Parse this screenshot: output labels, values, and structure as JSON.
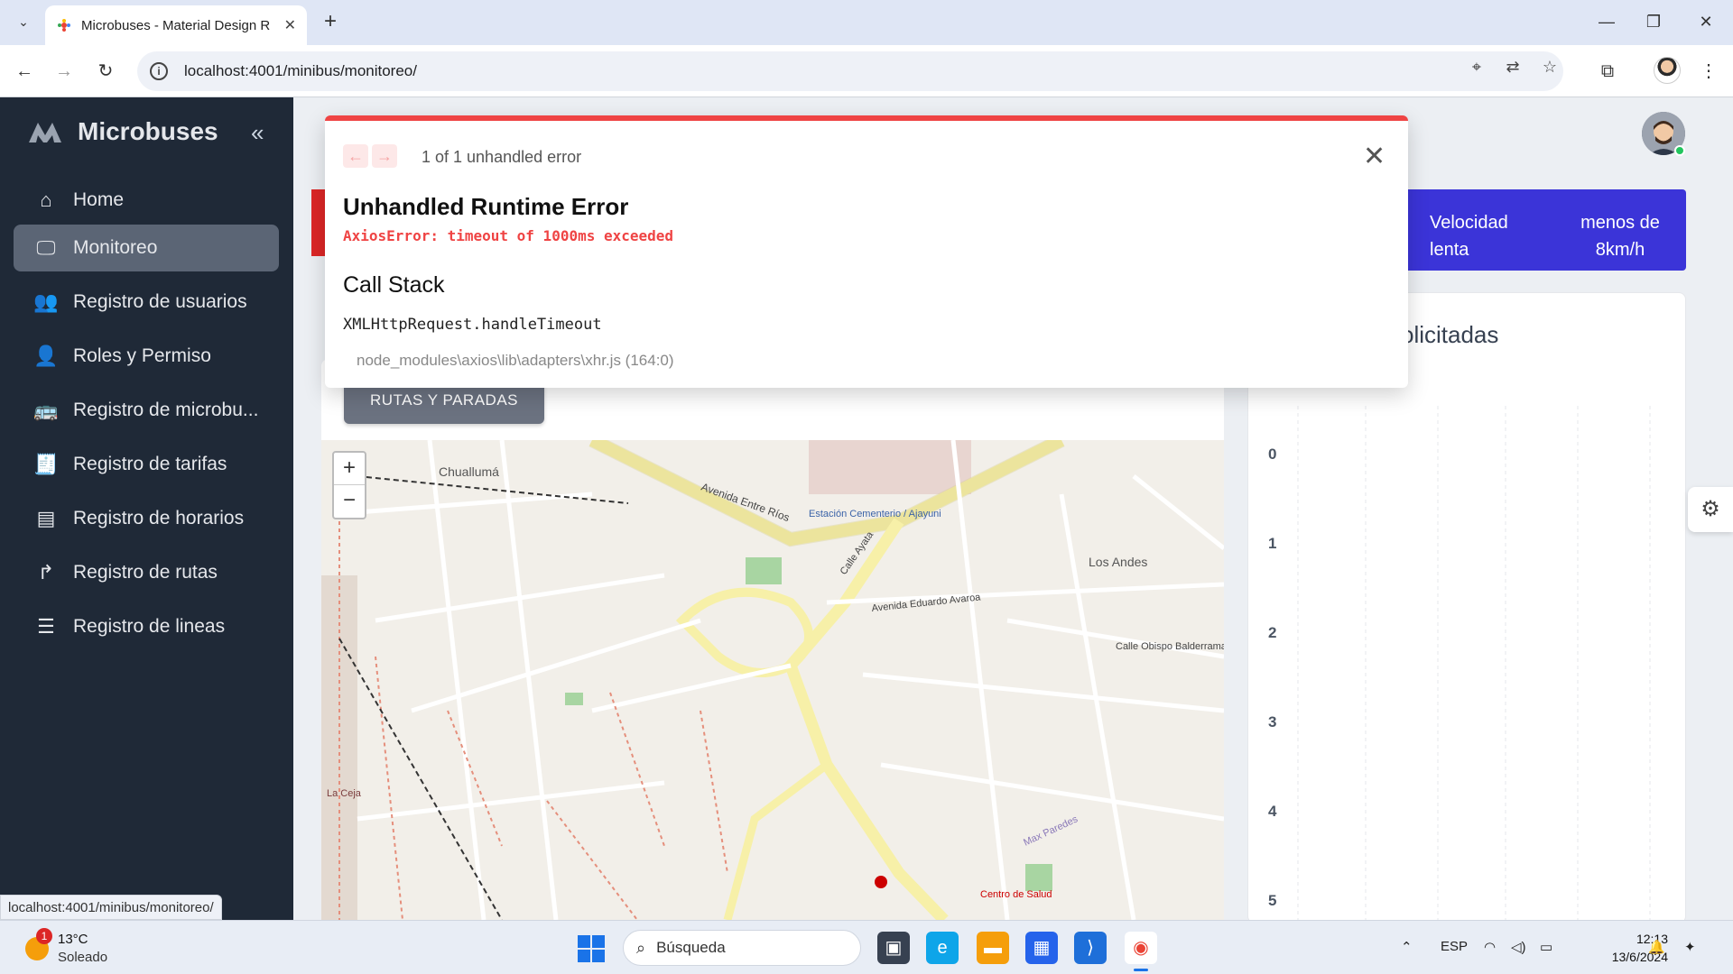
{
  "browser": {
    "tab_title": "Microbuses - Material Design R",
    "url": "localhost:4001/minibus/monitoreo/",
    "status_url": "localhost:4001/minibus/monitoreo/"
  },
  "sidebar": {
    "brand": "Microbuses",
    "items": [
      {
        "label": "Home",
        "icon": "home-icon"
      },
      {
        "label": "Monitoreo",
        "icon": "monitor-icon"
      },
      {
        "label": "Registro de usuarios",
        "icon": "users-icon"
      },
      {
        "label": "Roles y Permiso",
        "icon": "user-check-icon"
      },
      {
        "label": "Registro de microbu...",
        "icon": "bus-icon"
      },
      {
        "label": "Registro de tarifas",
        "icon": "receipt-icon"
      },
      {
        "label": "Registro de horarios",
        "icon": "schedule-icon"
      },
      {
        "label": "Registro de rutas",
        "icon": "route-icon"
      },
      {
        "label": "Registro de lineas",
        "icon": "list-icon"
      }
    ]
  },
  "main": {
    "speed_card": {
      "label": "Velocidad lenta",
      "value": "menos de 8km/h"
    },
    "routes_button": "RUTAS Y PARADAS",
    "chart_title": "olicitadas",
    "chart_ticks": [
      "0",
      "1",
      "2",
      "3",
      "4",
      "5"
    ],
    "map_zoom_in": "+",
    "map_zoom_out": "−",
    "map_labels": [
      "Chuallumá",
      "Avenida Entre Ríos",
      "Estación Cementerio / Ajayuni",
      "Los Andes",
      "Calle Ayata",
      "Avenida Eduardo Avaroa",
      "Max Paredes",
      "Centro de Salud",
      "La Ceja",
      "Calle Obispo Balderrama"
    ]
  },
  "error_dialog": {
    "counter": "1 of 1 unhandled error",
    "title": "Unhandled Runtime Error",
    "message": "AxiosError: timeout of 1000ms exceeded",
    "stack_heading": "Call Stack",
    "function": "XMLHttpRequest.handleTimeout",
    "file": "node_modules\\axios\\lib\\adapters\\xhr.js (164:0)"
  },
  "taskbar": {
    "temperature": "13°C",
    "weather": "Soleado",
    "weather_badge": "1",
    "search_placeholder": "Búsqueda",
    "lang": "ESP",
    "time": "12:13",
    "date": "13/6/2024"
  },
  "colors": {
    "sidebar_bg": "#1f2937",
    "active_item": "#5b6575",
    "error_accent": "#ef4444",
    "speed_card": "#3b34d8"
  }
}
